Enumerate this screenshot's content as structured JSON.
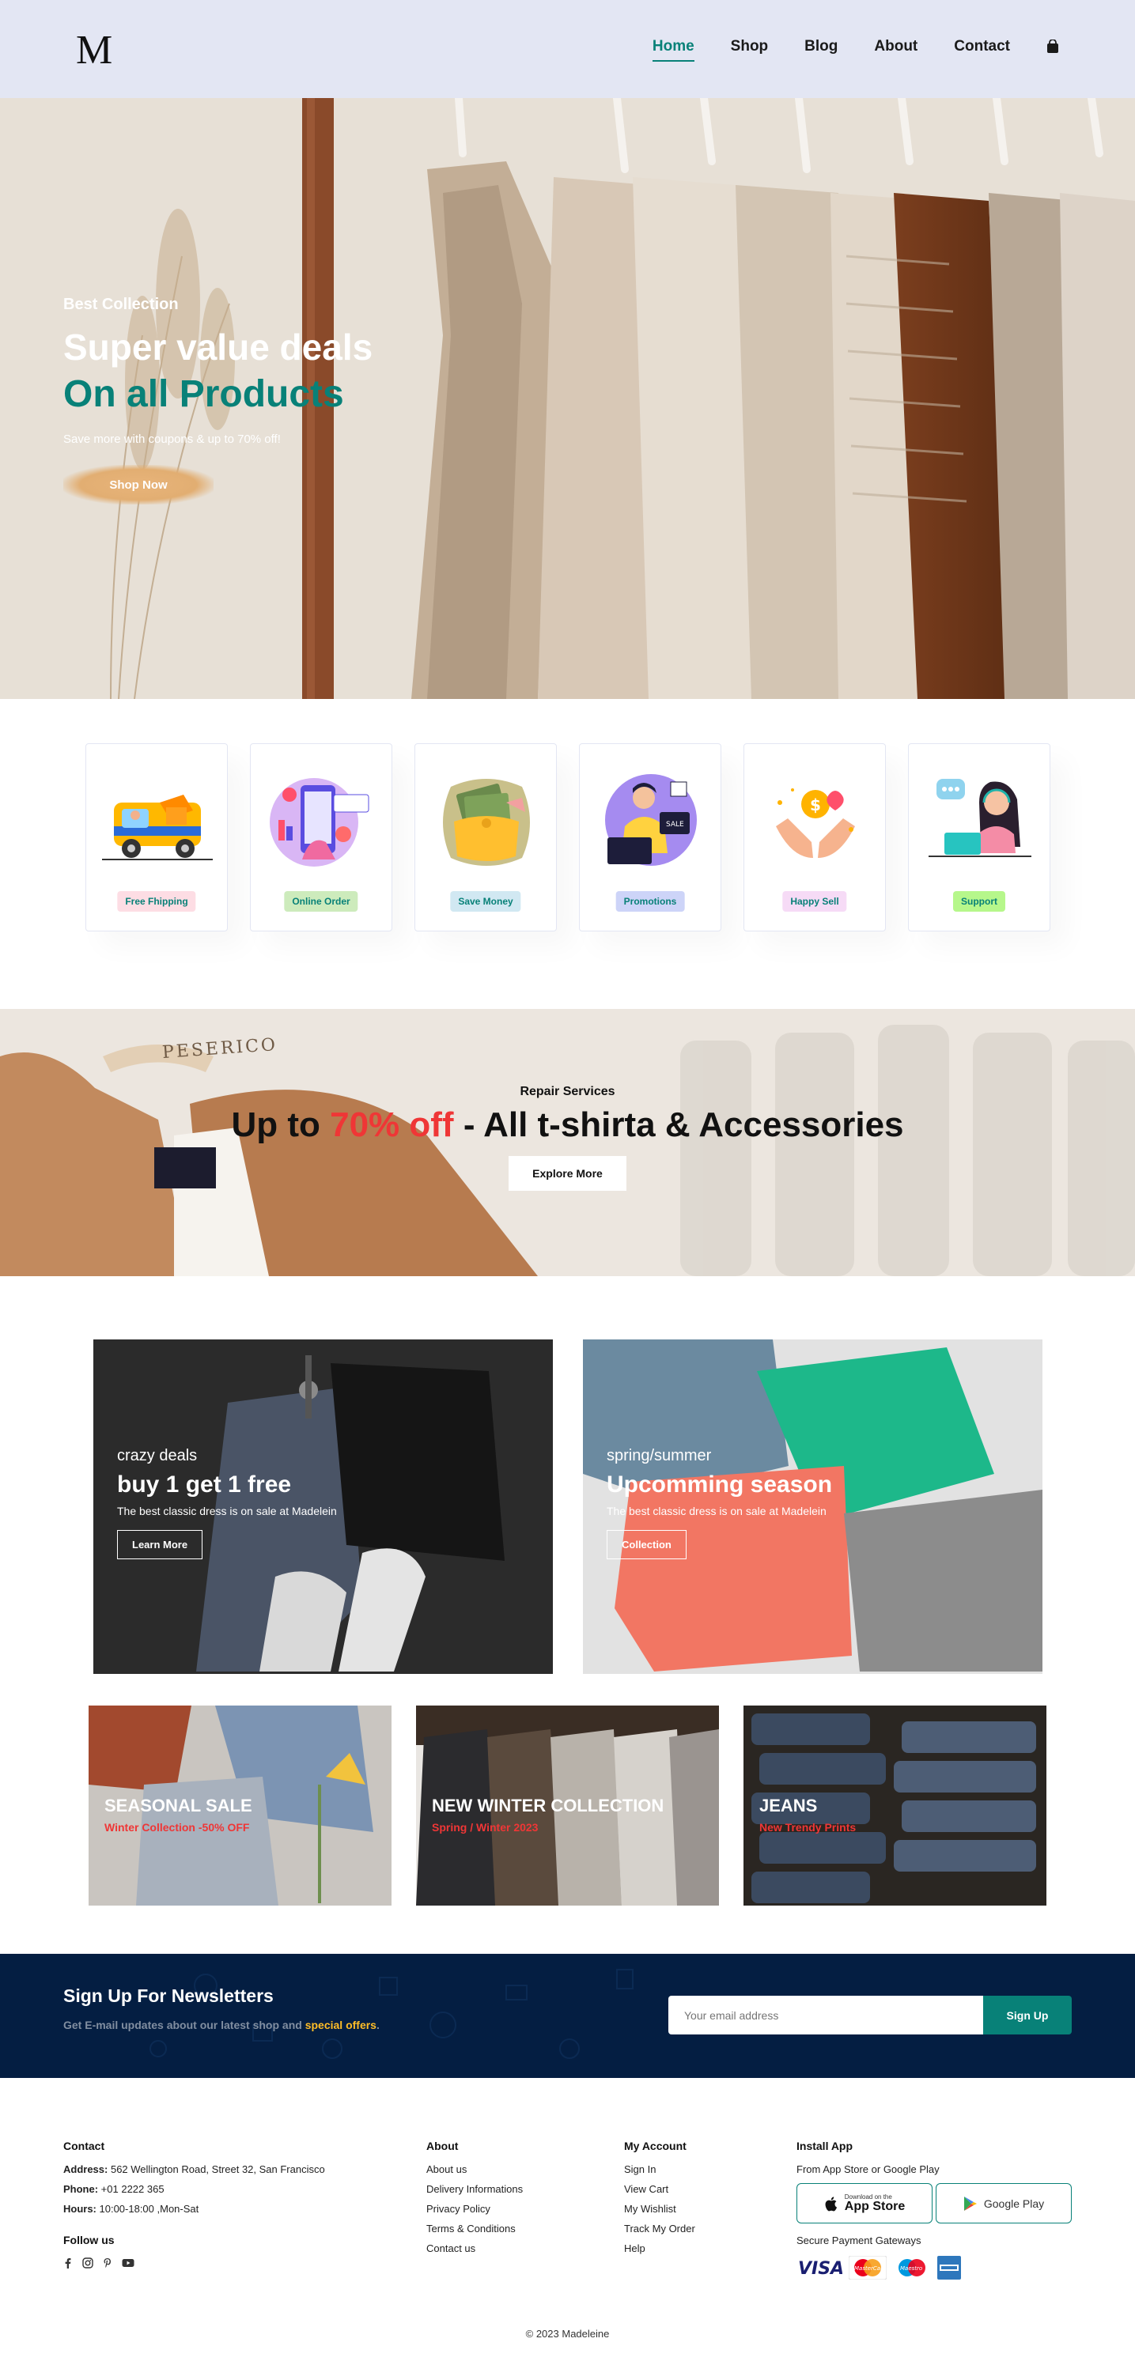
{
  "brand": {
    "logo": "M"
  },
  "nav": {
    "items": [
      "Home",
      "Shop",
      "Blog",
      "About",
      "Contact"
    ],
    "active": "Home",
    "cart_icon": "shopping-bag-icon"
  },
  "hero": {
    "kicker": "Best Collection",
    "title": "Super value deals",
    "title2": "On all Products",
    "subtitle": "Save more with coupons & up to 70% off!",
    "button": "Shop Now"
  },
  "features": [
    {
      "label": "Free Fhipping",
      "bg": "#fddde4"
    },
    {
      "label": "Online Order",
      "bg": "#cdebbc"
    },
    {
      "label": "Save Money",
      "bg": "#d1e8f2"
    },
    {
      "label": "Promotions",
      "bg": "#cdd4f8"
    },
    {
      "label": "Happy Sell",
      "bg": "#f6dbf6"
    },
    {
      "label": "Support",
      "bg": "#b6f78b"
    }
  ],
  "banner": {
    "kicker": "Repair Services",
    "title_pre": "Up to ",
    "title_highlight": "70% off",
    "title_post": " - All t-shirta & Accessories",
    "button": "Explore More",
    "hanger_text": "PESERICO"
  },
  "sm_banners": [
    {
      "kicker": "crazy deals",
      "title": "buy 1 get 1 free",
      "desc": "The best classic dress is on sale at Madelein",
      "button": "Learn More"
    },
    {
      "kicker": "spring/summer",
      "title": "Upcomming season",
      "desc": "The best classic dress is on sale at Madelein",
      "button": "Collection"
    }
  ],
  "banner3": [
    {
      "title": "SEASONAL SALE",
      "sub": "Winter Collection -50% OFF"
    },
    {
      "title": "NEW WINTER COLLECTION",
      "sub": "Spring / Winter 2023"
    },
    {
      "title": "JEANS",
      "sub": "New Trendy Prints"
    }
  ],
  "newsletter": {
    "title": "Sign Up For Newsletters",
    "desc_pre": "Get E-mail updates about our latest shop and ",
    "desc_highlight": "special offers",
    "desc_post": ".",
    "placeholder": "Your email address",
    "button": "Sign Up"
  },
  "footer": {
    "contact": {
      "heading": "Contact",
      "address_label": "Address:",
      "address": " 562 Wellington Road, Street 32, San Francisco",
      "phone_label": "Phone:",
      "phone": " +01 2222 365",
      "hours_label": "Hours:",
      "hours": " 10:00-18:00 ,Mon-Sat",
      "follow": "Follow us"
    },
    "about": {
      "heading": "About",
      "links": [
        "About us",
        "Delivery Informations",
        "Privacy Policy",
        "Terms & Conditions",
        "Contact us"
      ]
    },
    "account": {
      "heading": "My Account",
      "links": [
        "Sign In",
        "View Cart",
        "My Wishlist",
        "Track My Order",
        "Help"
      ]
    },
    "app": {
      "heading": "Install App",
      "desc": "From App Store or Google Play",
      "appstore_small": "Download on the",
      "appstore_big": "App Store",
      "googleplay": "Google Play",
      "payments": "Secure Payment Gateways",
      "visa": "VISA",
      "mastercard": "MasterCard",
      "maestro": "Maestro"
    },
    "copyright": "© 2023 Madeleine"
  },
  "colors": {
    "accent": "#088178",
    "header_bg": "#e3e6f3",
    "newsletter_bg": "#041e42",
    "highlight_red": "#ef3636",
    "highlight_yellow": "#ffbd27"
  }
}
